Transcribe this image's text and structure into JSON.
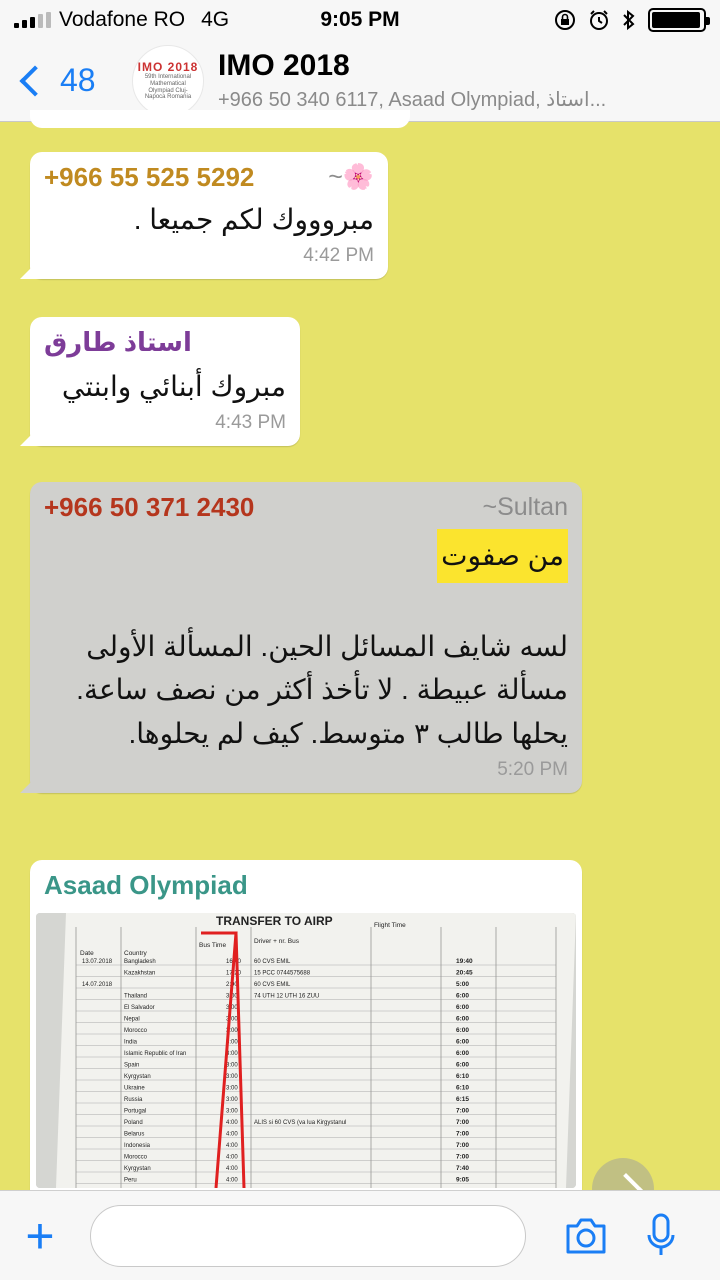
{
  "status_bar": {
    "carrier": "Vodafone RO",
    "network": "4G",
    "time": "9:05 PM",
    "battery_level": 0.95
  },
  "header": {
    "back_count": "48",
    "title": "IMO 2018",
    "members": "+966 50 340 6117, Asaad Olympiad, استاذ...",
    "avatar_logo": "IMO 2018",
    "avatar_sub": "59th International Mathematical Olympiad Cluj-Napoca Romania"
  },
  "messages": [
    {
      "sender": "+966 55 525 5292",
      "sender_name": "~🌸",
      "sender_color": "#c08a20",
      "text": "مبروووك لكم جميعا .",
      "time": "4:42 PM"
    },
    {
      "sender": "استاذ طارق",
      "sender_color": "#7d3c98",
      "text": "مبروك أبنائي وابنتي",
      "time": "4:43 PM"
    },
    {
      "sender": "+966 50 371 2430",
      "sender_name": "~Sultan",
      "sender_color": "#b5361d",
      "highlight": "من صفوت",
      "text": "لسه شايف المسائل الحين. المسألة الأولى مسألة عبيطة . لا تأخذ أكثر من نصف ساعة. يحلها طالب ٣ متوسط. كيف لم يحلوها.",
      "time": "5:20 PM"
    },
    {
      "sender": "Asaad Olympiad",
      "sender_color": "#3a9688",
      "photo": {
        "heading": "TRANSFER TO AIRP",
        "col_date": "Date",
        "col_country": "Country",
        "col_bus_time": "Bus Time",
        "col_driver": "Driver + nr. Bus",
        "col_flight": "Flight Time",
        "rows": [
          {
            "date": "13.07.2018",
            "country": "Bangladesh",
            "bus": "16:40",
            "driver": "60 CVS EMIL",
            "flight": "19:40"
          },
          {
            "date": "",
            "country": "Kazakhstan",
            "bus": "17:20",
            "driver": "15 PCC 0744575688",
            "flight": "20:45"
          },
          {
            "date": "14.07.2018",
            "country": "",
            "bus": "2:00",
            "driver": "60 CVS EMIL",
            "flight": "5:00"
          },
          {
            "date": "",
            "country": "Thailand",
            "bus": "3:00",
            "driver": "74 UTH 12 UTH 16 ZUU",
            "flight": "6:00"
          },
          {
            "date": "",
            "country": "El Salvador",
            "bus": "3:00",
            "driver": "",
            "flight": "6:00"
          },
          {
            "date": "",
            "country": "Nepal",
            "bus": "3:00",
            "driver": "",
            "flight": "6:00"
          },
          {
            "date": "",
            "country": "Morocco",
            "bus": "3:00",
            "driver": "",
            "flight": "6:00"
          },
          {
            "date": "",
            "country": "India",
            "bus": "3:00",
            "driver": "",
            "flight": "6:00"
          },
          {
            "date": "",
            "country": "Islamic Republic of Iran",
            "bus": "3:00",
            "driver": "",
            "flight": "6:00"
          },
          {
            "date": "",
            "country": "Spain",
            "bus": "3:00",
            "driver": "",
            "flight": "6:00"
          },
          {
            "date": "",
            "country": "Kyrgystan",
            "bus": "3:00",
            "driver": "",
            "flight": "6:10"
          },
          {
            "date": "",
            "country": "Ukraine",
            "bus": "3:00",
            "driver": "",
            "flight": "6:10"
          },
          {
            "date": "",
            "country": "Russia",
            "bus": "3:00",
            "driver": "",
            "flight": "6:15"
          },
          {
            "date": "",
            "country": "Portugal",
            "bus": "3:00",
            "driver": "",
            "flight": "7:00"
          },
          {
            "date": "",
            "country": "Poland",
            "bus": "4:00",
            "driver": "ALIS si 60 CVS (va lua Kirgystanul",
            "flight": "7:00"
          },
          {
            "date": "",
            "country": "Belarus",
            "bus": "4:00",
            "driver": "",
            "flight": "7:00"
          },
          {
            "date": "",
            "country": "Indonesia",
            "bus": "4:00",
            "driver": "",
            "flight": "7:00"
          },
          {
            "date": "",
            "country": "Morocco",
            "bus": "4:00",
            "driver": "",
            "flight": "7:00"
          },
          {
            "date": "",
            "country": "Kyrgystan",
            "bus": "4:00",
            "driver": "",
            "flight": "7:40"
          },
          {
            "date": "",
            "country": "Peru",
            "bus": "4:00",
            "driver": "",
            "flight": "9:05"
          }
        ]
      }
    }
  ],
  "input_bar": {
    "placeholder": ""
  }
}
